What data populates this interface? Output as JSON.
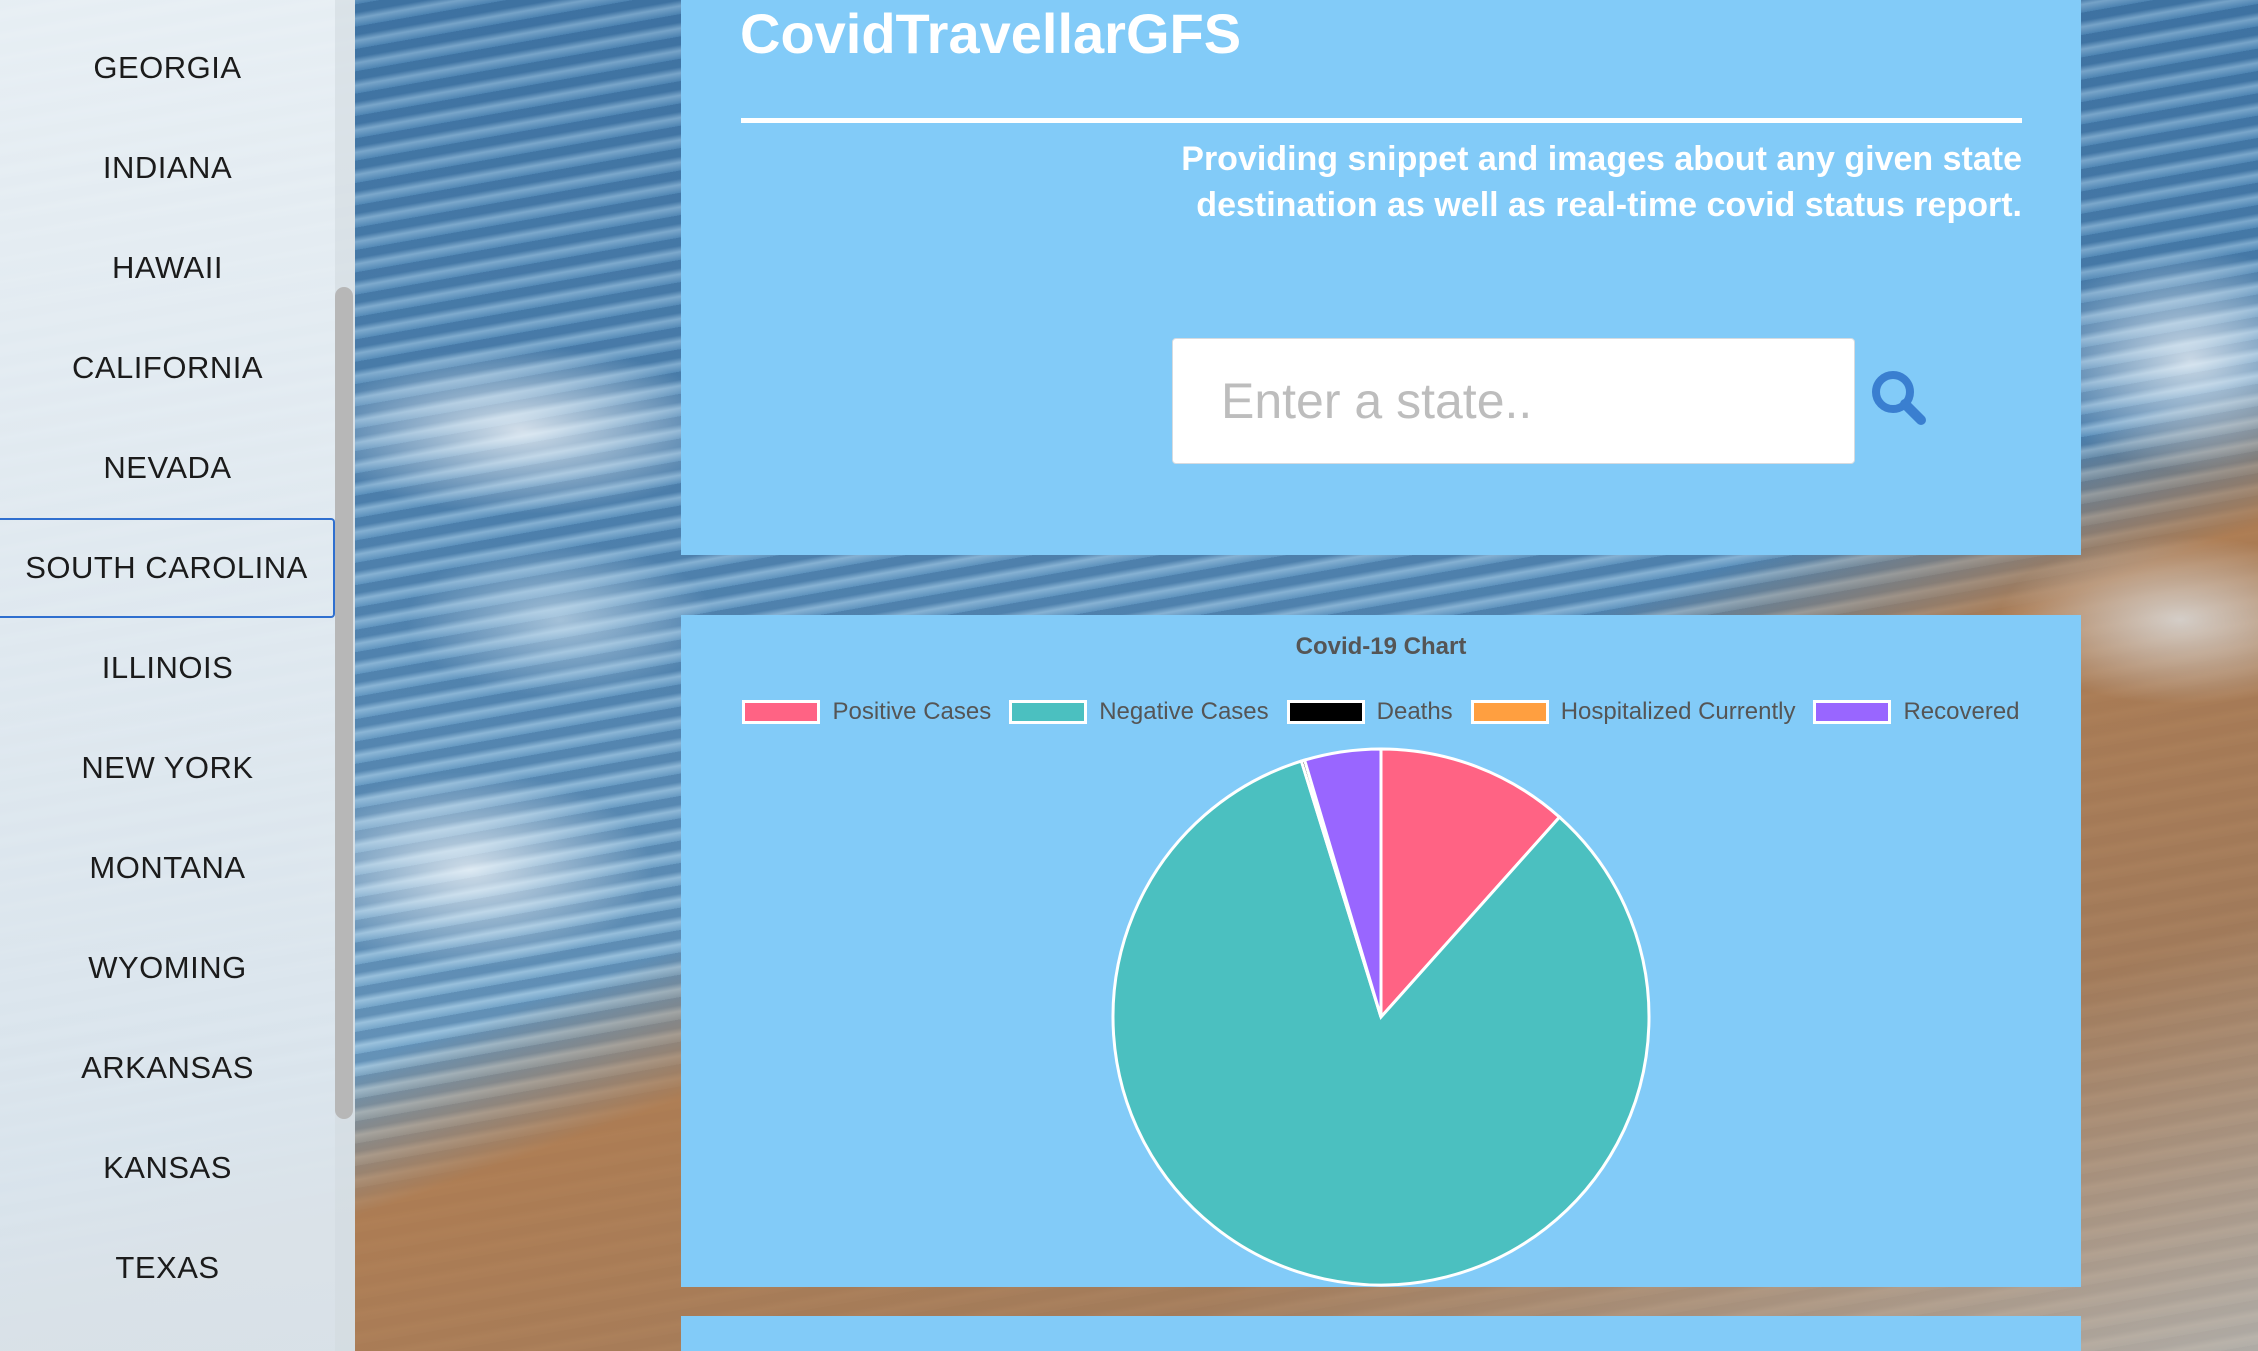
{
  "sidebar": {
    "items": [
      {
        "label": "GEORGIA"
      },
      {
        "label": "INDIANA"
      },
      {
        "label": "HAWAII"
      },
      {
        "label": "CALIFORNIA"
      },
      {
        "label": "NEVADA"
      },
      {
        "label": "SOUTH CAROLINA"
      },
      {
        "label": "ILLINOIS"
      },
      {
        "label": "NEW YORK"
      },
      {
        "label": "MONTANA"
      },
      {
        "label": "WYOMING"
      },
      {
        "label": "ARKANSAS"
      },
      {
        "label": "KANSAS"
      },
      {
        "label": "TEXAS"
      }
    ],
    "selected": "SOUTH CAROLINA"
  },
  "header": {
    "title": "CovidTravellarGFS",
    "subtitle": "Providing snippet and images about any given state destination as well as real-time covid status report."
  },
  "search": {
    "placeholder": "Enter a state..",
    "value": "",
    "icon": "search-icon"
  },
  "colors": {
    "panel": "#82cbf8",
    "accent": "#3a7fd0"
  },
  "chart_data": {
    "type": "pie",
    "title": "Covid-19 Chart",
    "legend_position": "top",
    "categories": [
      "Positive Cases",
      "Negative Cases",
      "Deaths",
      "Hospitalized Currently",
      "Recovered"
    ],
    "colors": [
      "#ff6384",
      "#4bc0c0",
      "#000000",
      "#ff9f40",
      "#9966ff"
    ],
    "values": [
      11.6,
      83.6,
      0.2,
      0.0,
      4.6
    ]
  }
}
